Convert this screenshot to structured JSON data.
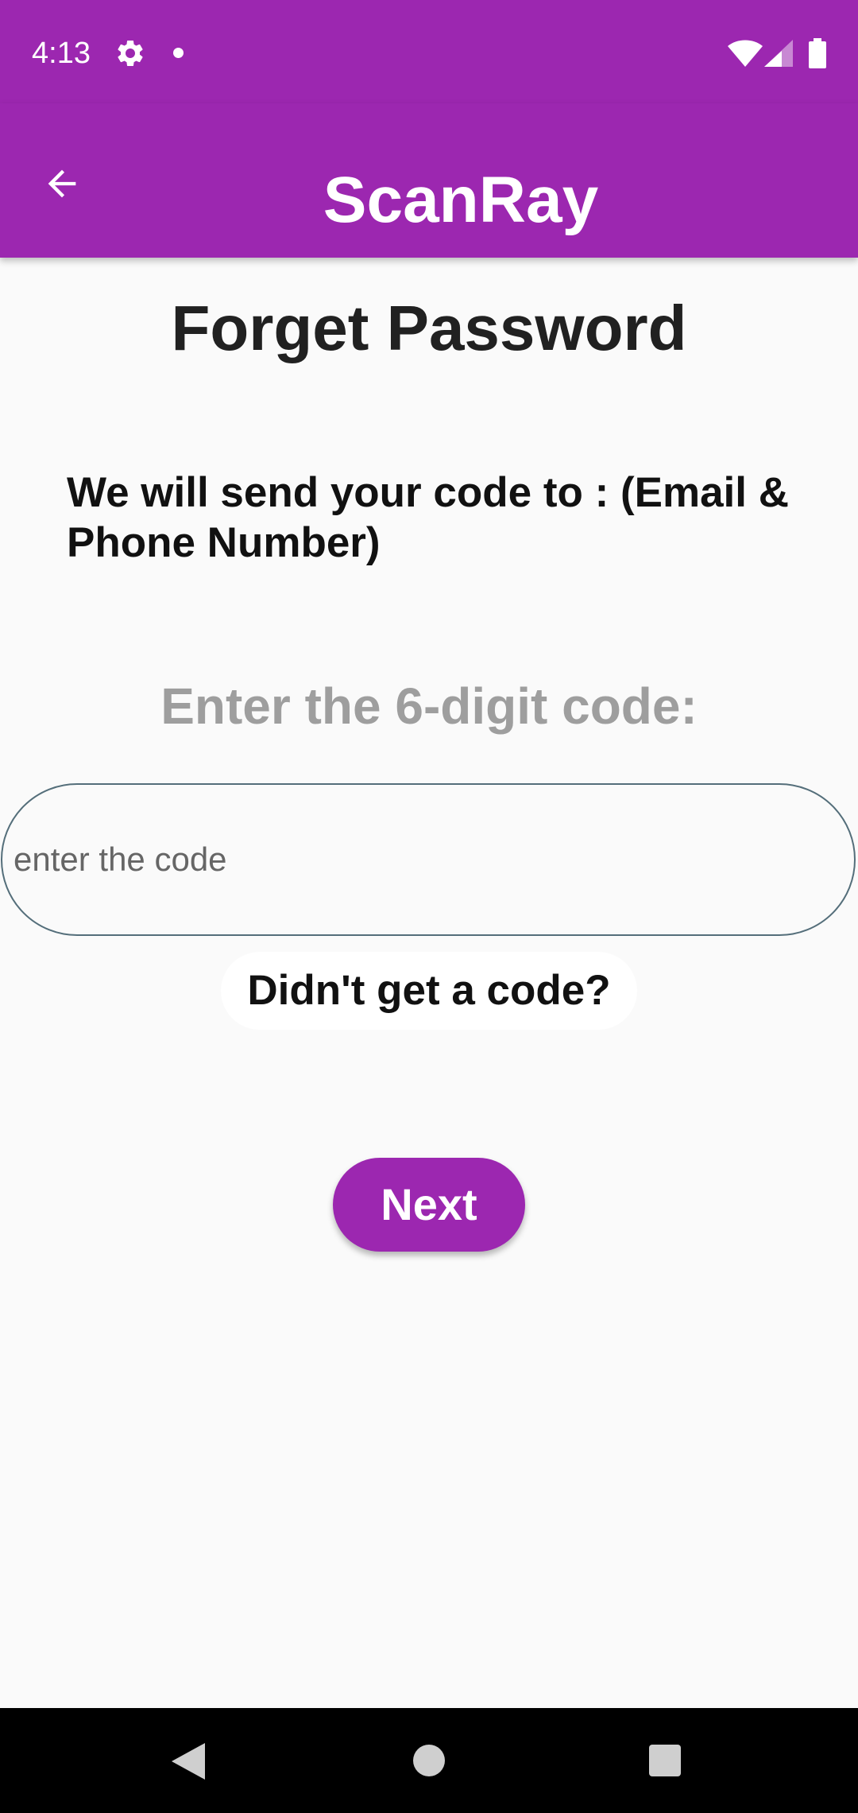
{
  "status_bar": {
    "time": "4:13",
    "icons": [
      "gear-icon",
      "notification-dot-icon",
      "wifi-icon",
      "signal-icon",
      "battery-icon"
    ]
  },
  "app_bar": {
    "title": "ScanRay",
    "back_icon": "arrow-back-icon",
    "background_color": "#9c27b0"
  },
  "main": {
    "heading": "Forget Password",
    "send_info": "We will send your code to : (Email & Phone Number)",
    "code_prompt": "Enter the 6-digit code:",
    "code_input": {
      "value": "",
      "placeholder": "enter the code"
    },
    "resend_label": "Didn't get a code?",
    "next_label": "Next"
  },
  "nav_bar": {
    "icons": [
      "back-triangle-icon",
      "home-circle-icon",
      "recents-square-icon"
    ]
  },
  "colors": {
    "accent": "#9c27b0",
    "prompt_gray": "#9e9e9e",
    "input_border": "#546e7a",
    "page_background": "#fafafa"
  }
}
